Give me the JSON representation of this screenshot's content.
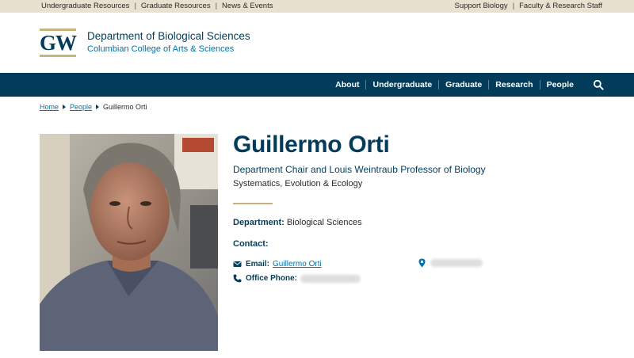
{
  "utility": {
    "left": [
      "Undergraduate Resources",
      "Graduate Resources",
      "News & Events"
    ],
    "right": [
      "Support Biology",
      "Faculty & Research Staff"
    ]
  },
  "brand": {
    "logo_text": "GW",
    "department": "Department of Biological Sciences",
    "college": "Columbian College of Arts & Sciences"
  },
  "nav": {
    "items": [
      "About",
      "Undergraduate",
      "Graduate",
      "Research",
      "People"
    ],
    "search_icon": "search-icon"
  },
  "breadcrumb": {
    "home": "Home",
    "people": "People",
    "current": "Guillermo Orti"
  },
  "profile": {
    "name": "Guillermo Orti",
    "title": "Department Chair and Louis Weintraub Professor of Biology",
    "subtitle": "Systematics, Evolution & Ecology",
    "department_label": "Department:",
    "department_value": "Biological Sciences",
    "contact_heading": "Contact:",
    "email_label": "Email:",
    "email_link": "Guillermo Orti",
    "phone_label": "Office Phone:"
  },
  "colors": {
    "navy": "#033c5a",
    "buff": "#c8b27e",
    "link": "#0073aa"
  }
}
